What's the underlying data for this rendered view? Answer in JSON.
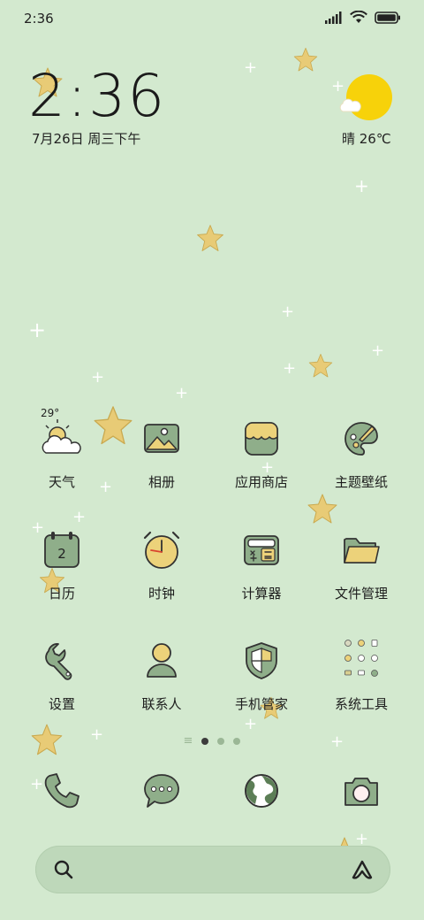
{
  "status_bar": {
    "time": "2:36"
  },
  "clock_widget": {
    "time": "2:36",
    "date": "7月26日 周三下午"
  },
  "weather_widget": {
    "condition_temp": "晴 26℃"
  },
  "weather_app_badge": "29°",
  "apps": [
    {
      "label": "天气",
      "icon": "weather-icon"
    },
    {
      "label": "相册",
      "icon": "gallery-icon"
    },
    {
      "label": "应用商店",
      "icon": "app-store-icon"
    },
    {
      "label": "主题壁纸",
      "icon": "theme-palette-icon"
    },
    {
      "label": "日历",
      "icon": "calendar-icon",
      "badge": "2"
    },
    {
      "label": "时钟",
      "icon": "clock-icon"
    },
    {
      "label": "计算器",
      "icon": "calculator-icon"
    },
    {
      "label": "文件管理",
      "icon": "folder-icon"
    },
    {
      "label": "设置",
      "icon": "wrench-icon"
    },
    {
      "label": "联系人",
      "icon": "contact-icon"
    },
    {
      "label": "手机管家",
      "icon": "shield-icon"
    },
    {
      "label": "系统工具",
      "icon": "tools-folder-icon"
    }
  ],
  "page_indicator": {
    "pages": 3,
    "current": 1
  },
  "dock": [
    {
      "icon": "phone-icon"
    },
    {
      "icon": "messages-icon"
    },
    {
      "icon": "browser-globe-icon"
    },
    {
      "icon": "camera-icon"
    }
  ],
  "search_bar": {
    "icon_left": "search-icon",
    "icon_right": "assistant-icon"
  },
  "colors": {
    "background": "#d3e9cf",
    "icon_green": "#8fae8a",
    "icon_yellow": "#ecd27a",
    "star": "#e8cb76",
    "sun": "#f7d20a"
  }
}
